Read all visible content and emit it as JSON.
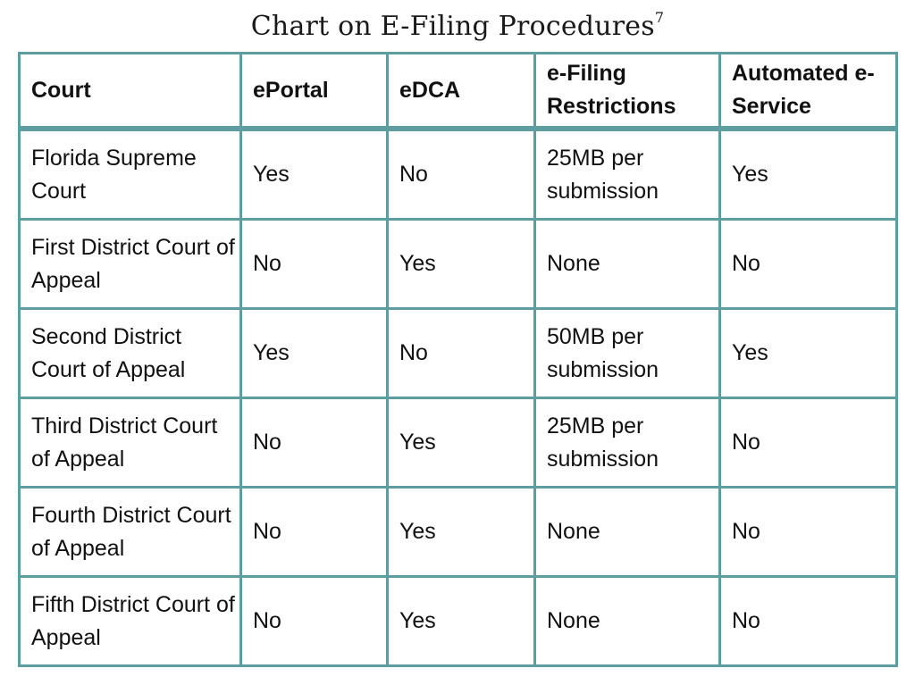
{
  "title": {
    "text": "Chart on E-Filing Procedures",
    "footnote": "7"
  },
  "table": {
    "headers": [
      "Court",
      "ePortal",
      "eDCA",
      "e-Filing Restrictions",
      "Automated e-Service"
    ],
    "rows": [
      [
        "Florida Supreme Court",
        "Yes",
        "No",
        "25MB per submission",
        "Yes"
      ],
      [
        "First District Court of Appeal",
        "No",
        "Yes",
        "None",
        "No"
      ],
      [
        "Second District Court of Appeal",
        "Yes",
        "No",
        "50MB per submission",
        "Yes"
      ],
      [
        "Third District Court of Appeal",
        "No",
        "Yes",
        "25MB per submission",
        "No"
      ],
      [
        "Fourth District Court of Appeal",
        "No",
        "Yes",
        "None",
        "No"
      ],
      [
        "Fifth District Court of Appeal",
        "No",
        "Yes",
        "None",
        "No"
      ]
    ]
  },
  "colors": {
    "border": "#5f9ea0",
    "text": "#111111"
  }
}
